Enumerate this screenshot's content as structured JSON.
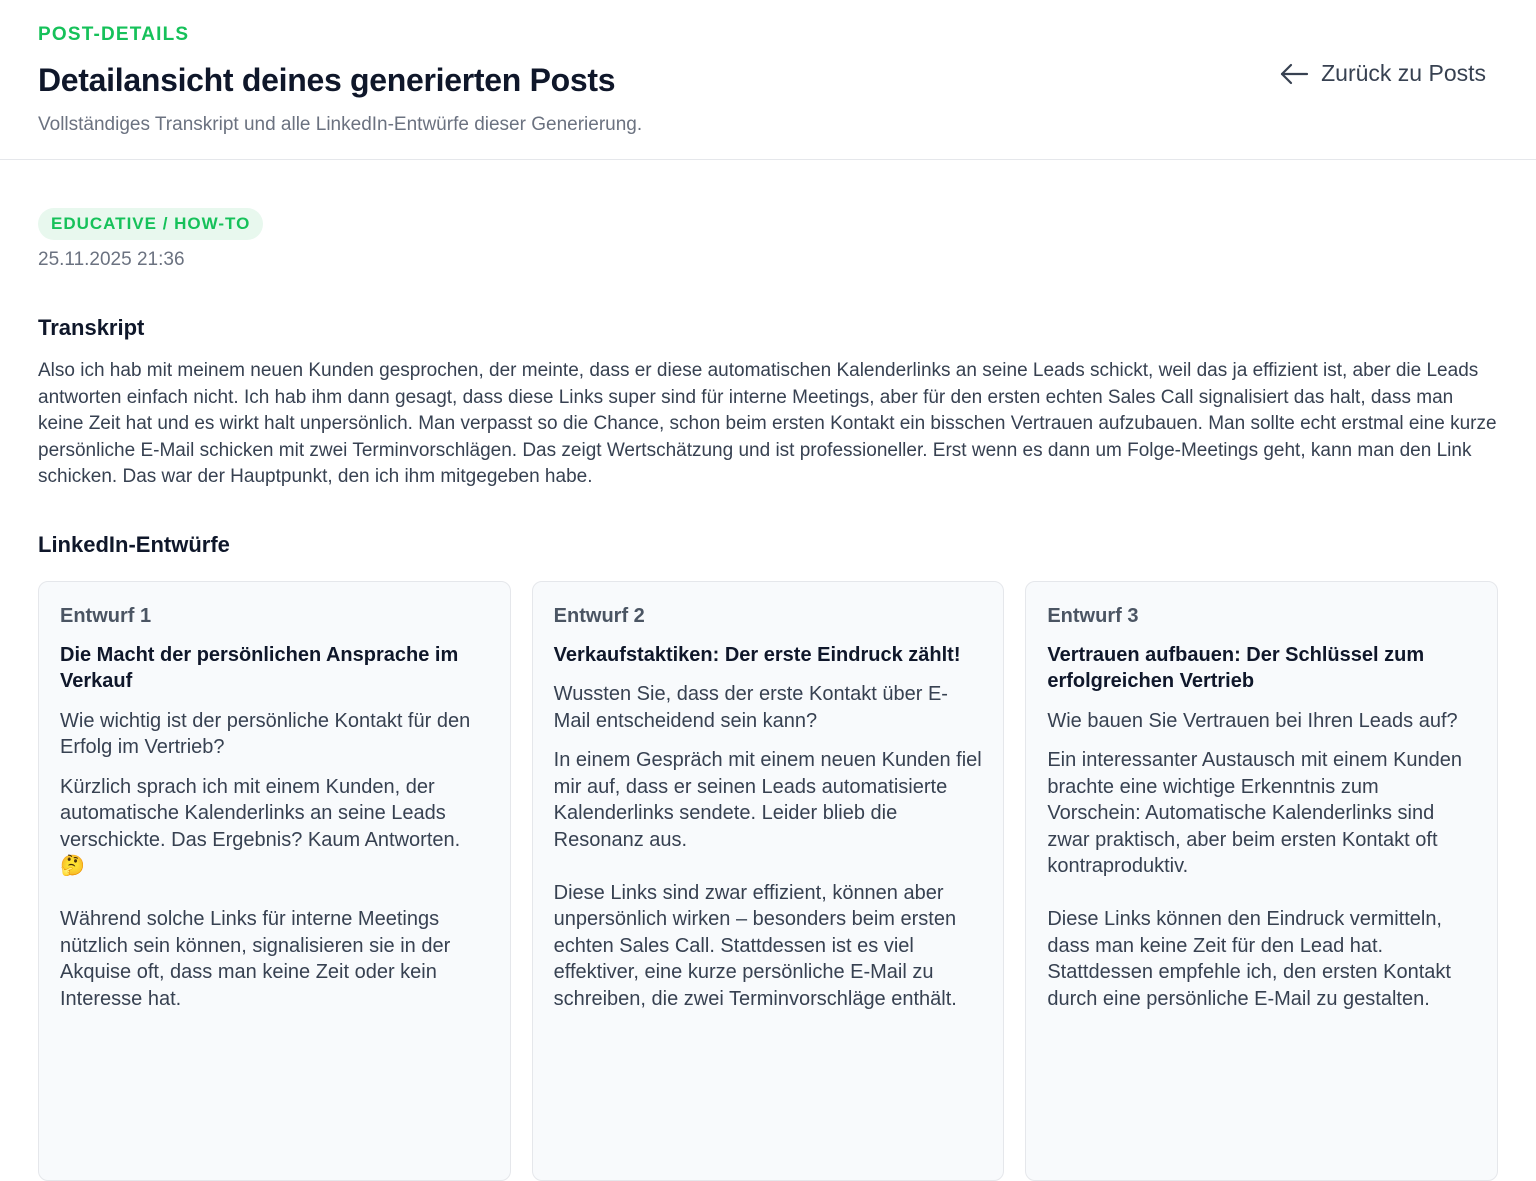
{
  "header": {
    "eyebrow": "POST-DETAILS",
    "title": "Detailansicht deines generierten Posts",
    "subtitle": "Vollständiges Transkript und alle LinkedIn-Entwürfe dieser Generierung.",
    "back_label": "Zurück zu Posts",
    "back_icon": "arrow-left-icon"
  },
  "post": {
    "category": "EDUCATIVE / HOW-TO",
    "date": "25.11.2025 21:36"
  },
  "transcript": {
    "title": "Transkript",
    "text": "Also ich hab mit meinem neuen Kunden gesprochen, der meinte, dass er diese automatischen Kalenderlinks an seine Leads schickt, weil das ja effizient ist, aber die Leads antworten einfach nicht. Ich hab ihm dann gesagt, dass diese Links super sind für interne Meetings, aber für den ersten echten Sales Call signalisiert das halt, dass man keine Zeit hat und es wirkt halt unpersönlich. Man verpasst so die Chance, schon beim ersten Kontakt ein bisschen Vertrauen aufzubauen. Man sollte echt erstmal eine kurze persönliche E-Mail schicken mit zwei Terminvorschlägen. Das zeigt Wertschätzung und ist professioneller. Erst wenn es dann um Folge-Meetings geht, kann man den Link schicken. Das war der Hauptpunkt, den ich ihm mitgegeben habe."
  },
  "drafts_section": {
    "title": "LinkedIn-Entwürfe",
    "drafts": [
      {
        "label": "Entwurf 1",
        "headline": "Die Macht der persönlichen Ansprache im Verkauf",
        "hook": "Wie wichtig ist der persönliche Kontakt für den Erfolg im Vertrieb?",
        "body": "Kürzlich sprach ich mit einem Kunden, der automatische Kalenderlinks an seine Leads verschickte. Das Ergebnis? Kaum Antworten. 🤔\n\nWährend solche Links für interne Meetings nützlich sein können, signalisieren sie in der Akquise oft, dass man keine Zeit oder kein Interesse hat."
      },
      {
        "label": "Entwurf 2",
        "headline": "Verkaufstaktiken: Der erste Eindruck zählt!",
        "hook": "Wussten Sie, dass der erste Kontakt über E-Mail entscheidend sein kann?",
        "body": "In einem Gespräch mit einem neuen Kunden fiel mir auf, dass er seinen Leads automatisierte Kalenderlinks sendete. Leider blieb die Resonanz aus.\n\nDiese Links sind zwar effizient, können aber unpersönlich wirken – besonders beim ersten echten Sales Call. Stattdessen ist es viel effektiver, eine kurze persönliche E-Mail zu schreiben, die zwei Terminvorschläge enthält."
      },
      {
        "label": "Entwurf 3",
        "headline": "Vertrauen aufbauen: Der Schlüssel zum erfolgreichen Vertrieb",
        "hook": "Wie bauen Sie Vertrauen bei Ihren Leads auf?",
        "body": "Ein interessanter Austausch mit einem Kunden brachte eine wichtige Erkenntnis zum Vorschein: Automatische Kalenderlinks sind zwar praktisch, aber beim ersten Kontakt oft kontraproduktiv.\n\nDiese Links können den Eindruck vermitteln, dass man keine Zeit für den Lead hat. Stattdessen empfehle ich, den ersten Kontakt durch eine persönliche E-Mail zu gestalten."
      }
    ]
  },
  "colors": {
    "accent": "#16c15a",
    "badge_bg": "#e8f8ee",
    "card_bg": "#f8fafc",
    "border": "#e5e7eb"
  }
}
